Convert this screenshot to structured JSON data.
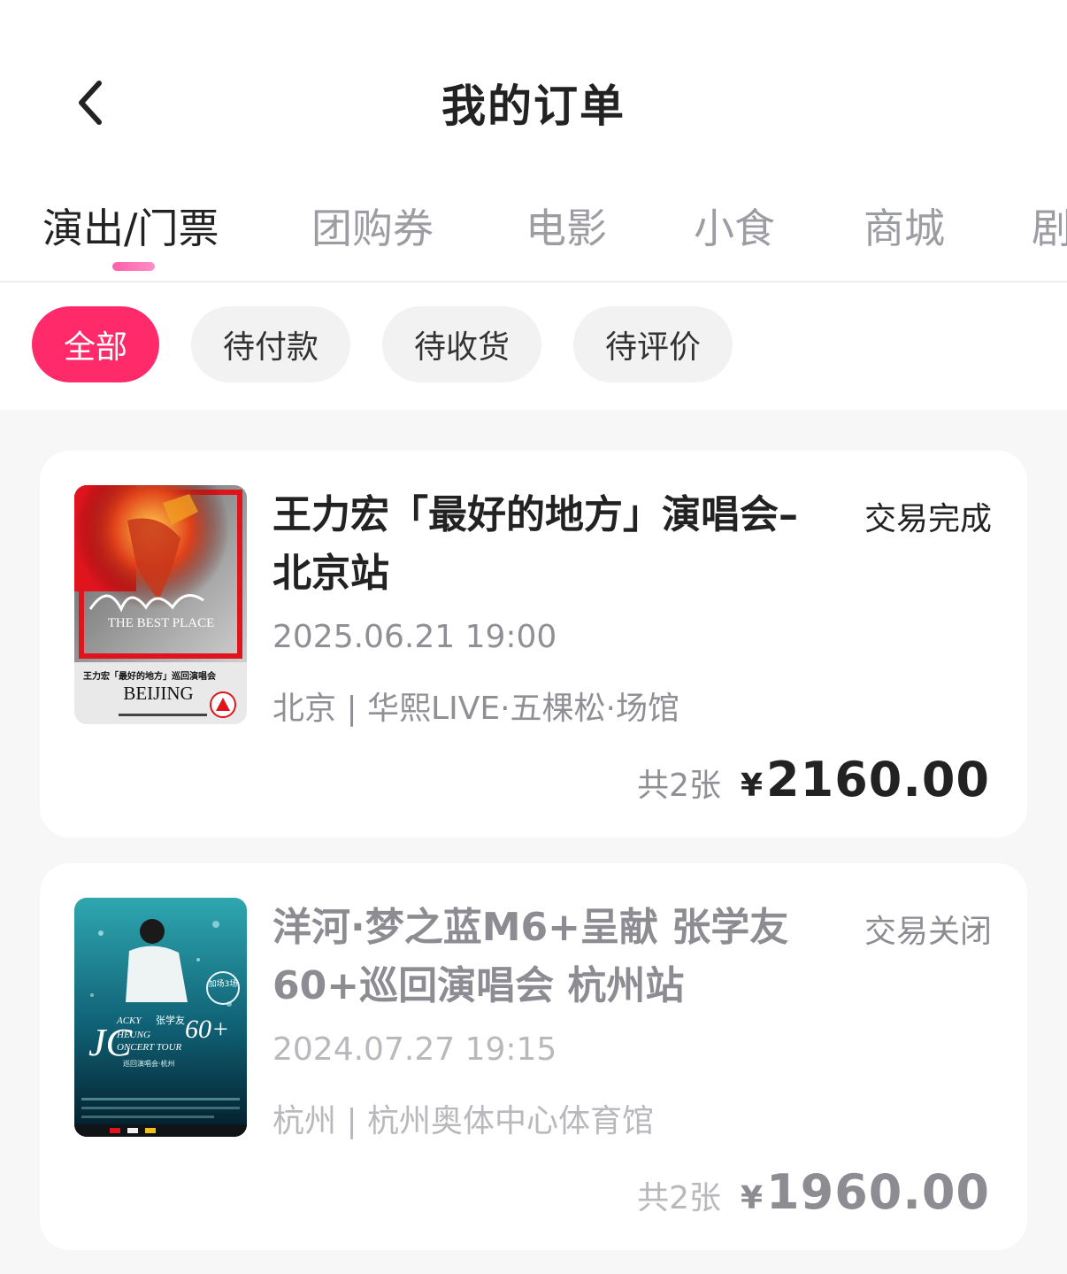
{
  "header": {
    "title": "我的订单"
  },
  "tabs": [
    {
      "label": "演出/门票",
      "active": true
    },
    {
      "label": "团购券"
    },
    {
      "label": "电影"
    },
    {
      "label": "小食"
    },
    {
      "label": "商城"
    },
    {
      "label": "剧"
    }
  ],
  "filters": [
    {
      "label": "全部",
      "active": true
    },
    {
      "label": "待付款"
    },
    {
      "label": "待收货"
    },
    {
      "label": "待评价"
    }
  ],
  "orders": [
    {
      "title": "王力宏「最好的地方」演唱会–北京站",
      "status": "交易完成",
      "datetime": "2025.06.21 19:00",
      "venue": "北京 | 华熙LIVE·五棵松·场馆",
      "count": "共2张",
      "currency": "¥",
      "amount": "2160.00",
      "poster": {
        "script_text": "最好的地方",
        "subtitle": "THE BEST PLACE",
        "tour": "王力宏「最好的地方」巡回演唱会",
        "city": "BEIJING"
      }
    },
    {
      "title": "洋河·梦之蓝M6+呈献 张学友60+巡回演唱会 杭州站",
      "status": "交易关闭",
      "datetime": "2024.07.27 19:15",
      "venue": "杭州 | 杭州奥体中心体育馆",
      "count": "共2张",
      "currency": "¥",
      "amount": "1960.00",
      "poster": {
        "badge": "加场3场",
        "name_cn": "张学友",
        "initials": "JC",
        "name_en_1": "ACKY",
        "name_en_2": "HEUNG",
        "tour": "ONCERT TOUR",
        "sixty": "60+",
        "city": "巡回演唱会·杭州"
      }
    }
  ],
  "colors": {
    "accent": "#ff2a6a",
    "tab_indicator": "#ff5fa8",
    "text_primary": "#222222",
    "text_secondary": "#8f8f95",
    "background": "#f7f7f7"
  },
  "icons": {
    "back": "chevron-left-icon"
  }
}
